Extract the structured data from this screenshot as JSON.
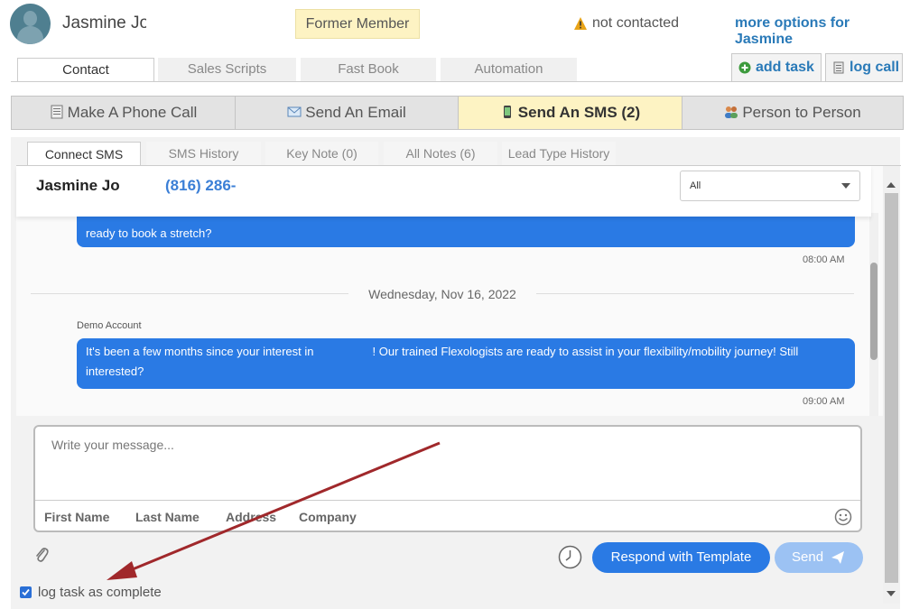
{
  "contact": {
    "name": "Jasmine Jo",
    "status_pill": "Former Member",
    "contact_status": "not contacted",
    "more_options": "more options for Jasmine"
  },
  "top_tabs": [
    {
      "label": "Contact",
      "active": true
    },
    {
      "label": "Sales Scripts",
      "active": false
    },
    {
      "label": "Fast Book",
      "active": false
    },
    {
      "label": "Automation",
      "active": false
    }
  ],
  "actions": {
    "add_task": "add task",
    "log_call": "log call"
  },
  "channels": [
    {
      "label": "Make A Phone Call",
      "icon": "phone-doc-icon",
      "active": false
    },
    {
      "label": "Send An Email",
      "icon": "envelope-icon",
      "active": false
    },
    {
      "label": "Send An SMS (2)",
      "icon": "mobile-phone-icon",
      "active": true
    },
    {
      "label": "Person to Person",
      "icon": "people-icon",
      "active": false
    }
  ],
  "sub_tabs": [
    {
      "label": "Connect SMS",
      "active": true
    },
    {
      "label": "SMS History",
      "active": false
    },
    {
      "label": "Key Note (0)",
      "active": false
    },
    {
      "label": "All Notes (6)",
      "active": false
    },
    {
      "label": "Lead Type History",
      "active": false
    }
  ],
  "conversation": {
    "contact_name": "Jasmine Jo",
    "phone": "(816) 286-",
    "filter_value": "All",
    "messages": [
      {
        "text": "ready to book a stretch?",
        "time": "08:00 AM"
      },
      {
        "sender": "Demo Account",
        "text": "It's been a few months since your interest in                  ! Our trained Flexologists are ready to assist in your flexibility/mobility journey! Still interested?",
        "time": "09:00 AM"
      }
    ],
    "day_separator": "Wednesday, Nov 16, 2022"
  },
  "compose": {
    "placeholder": "Write your message...",
    "merge_fields": [
      "First Name",
      "Last Name",
      "Address",
      "Company"
    ],
    "template_button": "Respond with Template",
    "send_button": "Send"
  },
  "log_task": {
    "label": "log task as complete",
    "checked": true
  },
  "colors": {
    "accent_blue": "#2a7ae4",
    "link_blue": "#2a7ab8",
    "highlight_yellow": "#fdf3c3",
    "annotation_red": "#a0282b"
  }
}
